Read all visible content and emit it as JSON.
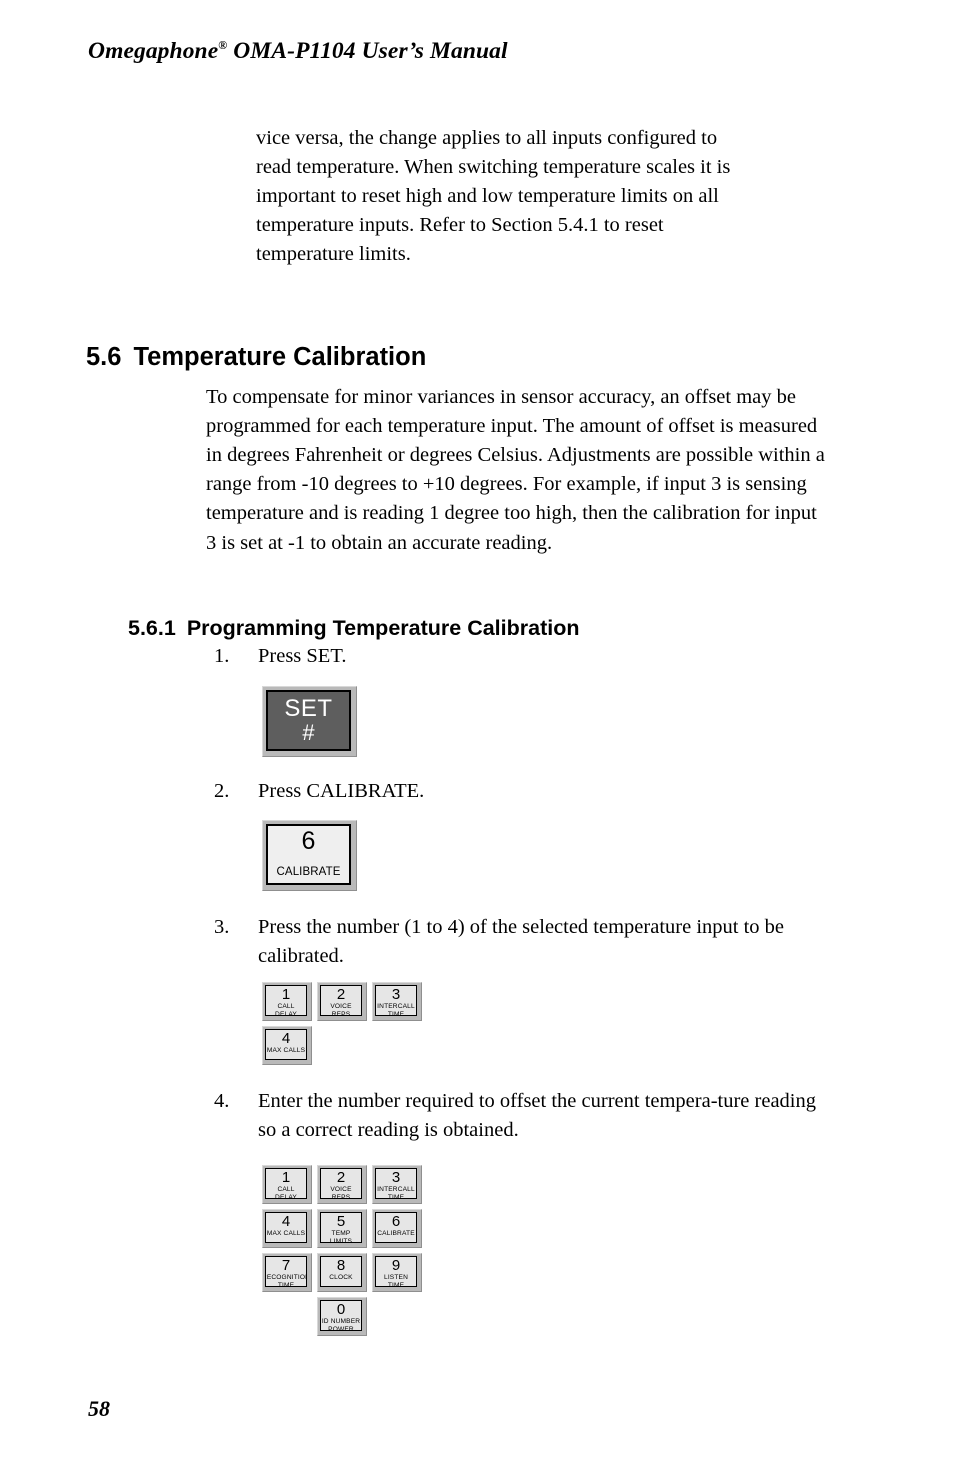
{
  "header": {
    "title_main": "Omegaphone",
    "registered_mark": "®",
    "title_rest": " OMA-P1104 User’s Manual"
  },
  "intro_paragraph": "vice versa, the change applies to all inputs configured to read temperature. When switching temperature scales it is important to reset high and low temperature limits on all temperature inputs. Refer to Section 5.4.1 to reset temperature limits.",
  "section": {
    "number": "5.6",
    "title": "Temperature Calibration",
    "paragraph": "To compensate for minor variances in sensor accuracy, an offset may be programmed for each temperature input. The amount of offset is measured in degrees Fahrenheit or degrees Celsius. Adjustments are possible within a range from -10 degrees to +10 degrees. For example, if input 3 is sensing temperature and is reading 1 degree too high, then the calibration for input 3 is set at -1 to obtain an accurate reading."
  },
  "subsection": {
    "number": "5.6.1",
    "title": "Programming Temperature Calibration"
  },
  "steps": [
    {
      "number": "1.",
      "text": "Press SET."
    },
    {
      "number": "2.",
      "text": "Press CALIBRATE."
    },
    {
      "number": "3.",
      "text": "Press the number (1 to 4) of the selected temperature input to be calibrated."
    },
    {
      "number": "4.",
      "text": "Enter the number required to offset the current tempera-ture reading so a correct reading is obtained."
    }
  ],
  "keys": {
    "set": {
      "main": "SET",
      "sub": "#"
    },
    "calibrate": {
      "main": "6",
      "sub": "CALIBRATE"
    },
    "step3_keypad": [
      {
        "main": "1",
        "sub": "CALL\nDELAY"
      },
      {
        "main": "2",
        "sub": "VOICE\nREPS"
      },
      {
        "main": "3",
        "sub": "INTERCALL\nTIME"
      },
      {
        "main": "4",
        "sub": "MAX CALLS"
      }
    ],
    "step4_keypad": [
      {
        "main": "1",
        "sub": "CALL\nDELAY"
      },
      {
        "main": "2",
        "sub": "VOICE\nREPS"
      },
      {
        "main": "3",
        "sub": "INTERCALL\nTIME"
      },
      {
        "main": "4",
        "sub": "MAX CALLS"
      },
      {
        "main": "5",
        "sub": "TEMP LIMITS"
      },
      {
        "main": "6",
        "sub": "CALIBRATE"
      },
      {
        "main": "7",
        "sub": "RECOGNITION\nTIME"
      },
      {
        "main": "8",
        "sub": "CLOCK"
      },
      {
        "main": "9",
        "sub": "LISTEN TIME\nSOUND"
      },
      {
        "main": "0",
        "sub": "ID NUMBER\nPOWER"
      }
    ]
  },
  "page_number": "58",
  "colors": {
    "key_dark_face": "#5e5e5e",
    "key_light_face": "#efefef",
    "key_bevel": "#b9b9b9",
    "text": "#000000",
    "page_background": "#ffffff"
  }
}
